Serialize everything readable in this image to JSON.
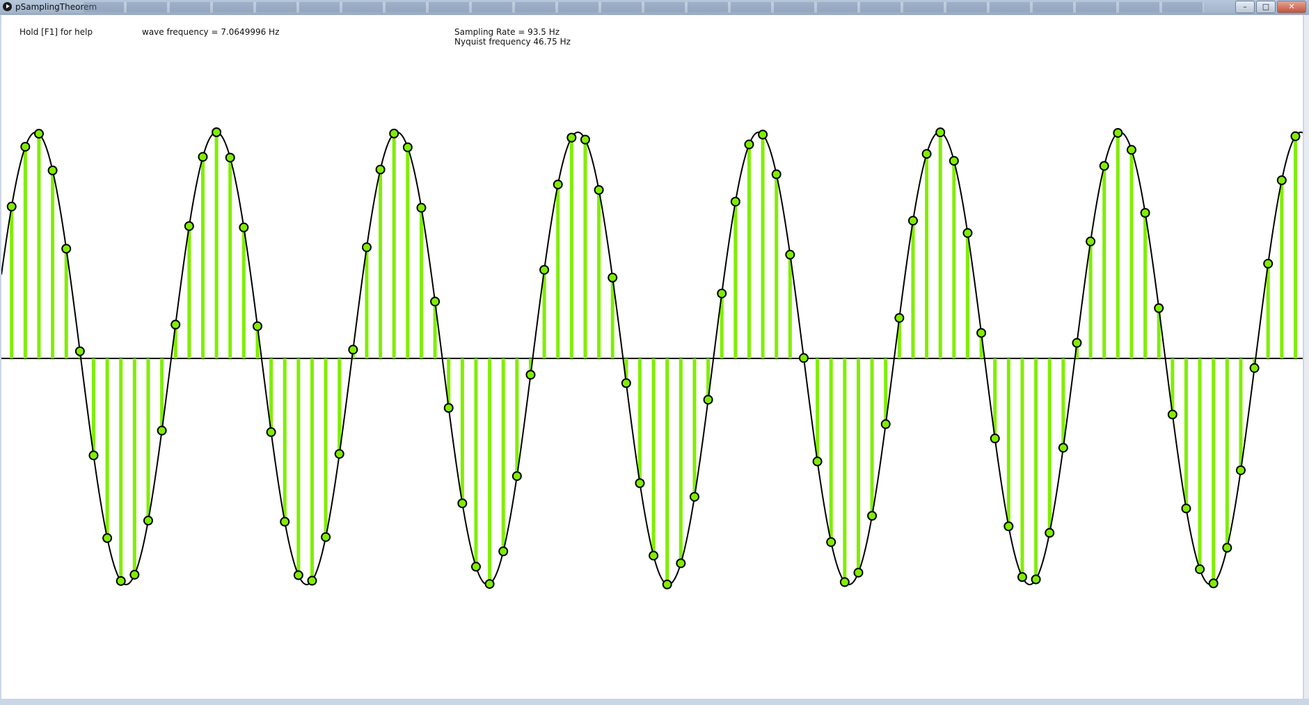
{
  "window": {
    "title": "pSamplingTheorem",
    "controls": {
      "minimize": "–",
      "maximize": "□",
      "close": "✕"
    }
  },
  "hud": {
    "help_hint": "Hold [F1] for help",
    "wave_frequency": "wave frequency = 7.0649996 Hz",
    "sampling_rate": "Sampling Rate = 93.5 Hz",
    "nyquist": "Nyquist frequency 46.75 Hz"
  },
  "signal": {
    "wave_frequency_hz": 7.0649996,
    "sampling_rate_hz": 93.5,
    "nyquist_hz": 46.75,
    "wave_cycles_visible": 7.2,
    "sample_count": 93
  },
  "colors": {
    "stem": "#80ee00",
    "marker_fill": "#80ee00",
    "marker_stroke": "#000000",
    "wave": "#000000",
    "axis": "#000000",
    "canvas_bg": "#ffffff"
  },
  "icons": {
    "app": "processing-play-icon",
    "minimize": "minimize-icon",
    "maximize": "maximize-icon",
    "close": "close-icon"
  }
}
